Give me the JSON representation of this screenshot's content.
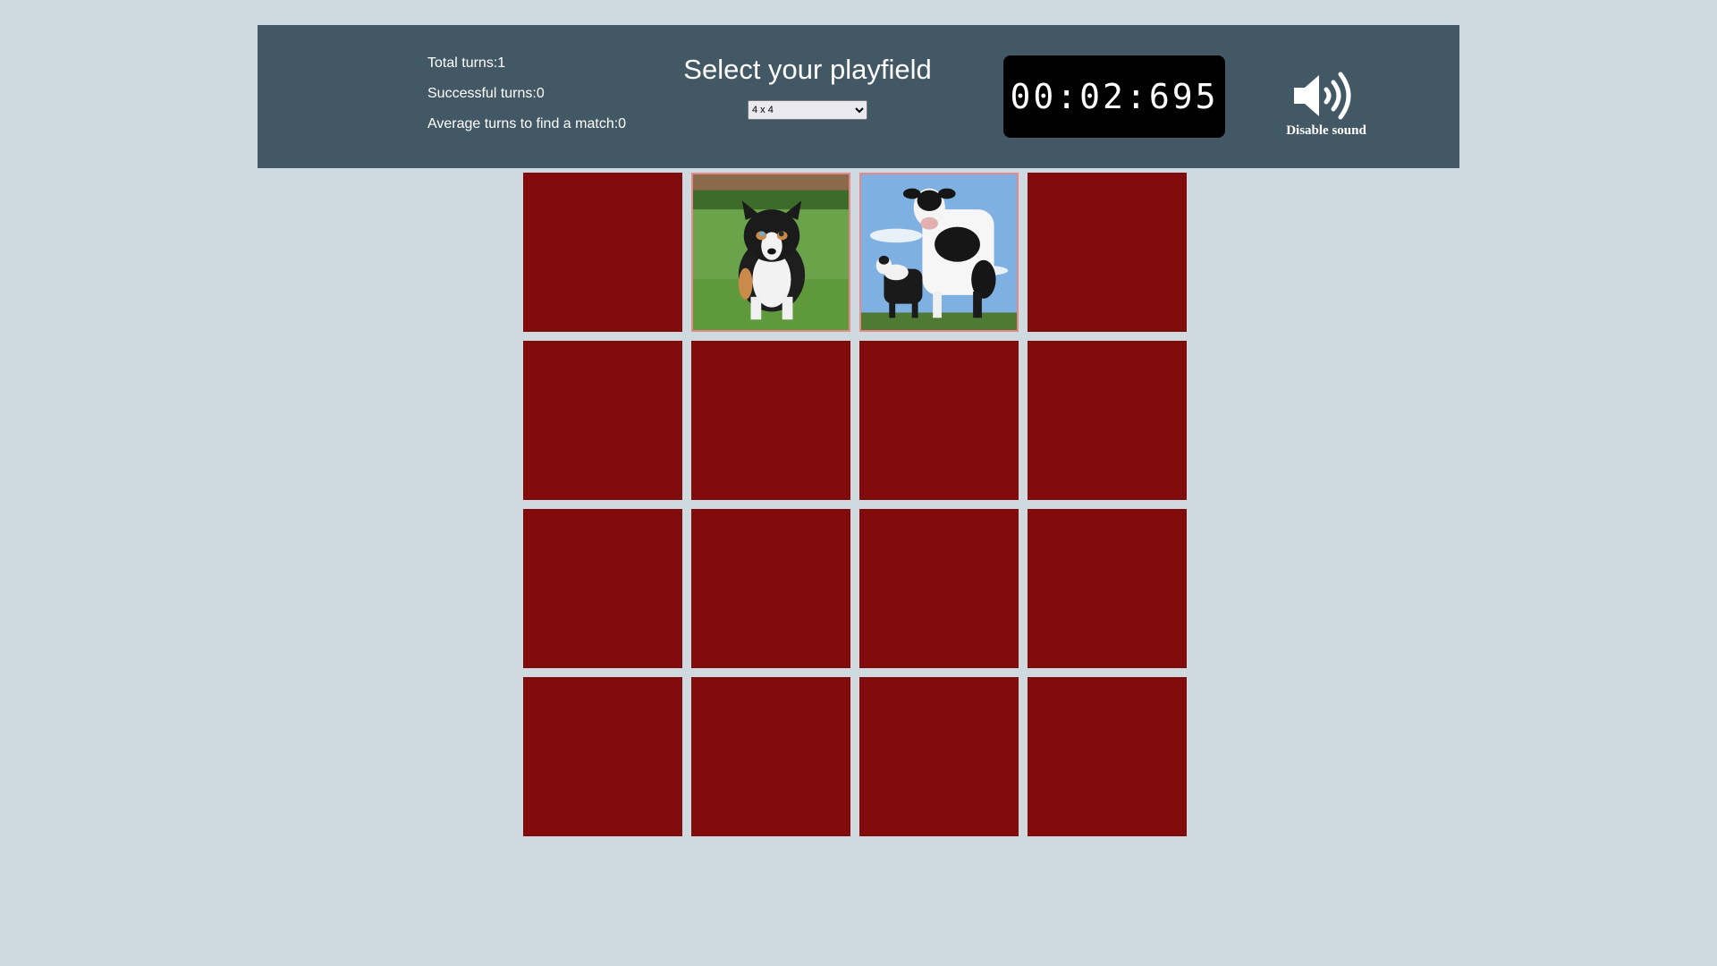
{
  "stats": {
    "total_turns": "Total turns:1",
    "successful_turns": "Successful turns:0",
    "average_turns": "Average turns to find a match:0"
  },
  "playfield": {
    "title": "Select your playfield",
    "selected": "4 x 4"
  },
  "timer": {
    "display": "00:02:695"
  },
  "sound": {
    "label": "Disable sound",
    "icon": "speaker-icon"
  },
  "board": {
    "rows": 4,
    "cols": 4,
    "card_back_color": "#820b0b",
    "flipped_border_color": "#e6878a",
    "cards": [
      {
        "state": "hidden"
      },
      {
        "state": "flipped",
        "image": "puppy"
      },
      {
        "state": "flipped",
        "image": "cows"
      },
      {
        "state": "hidden"
      },
      {
        "state": "hidden"
      },
      {
        "state": "hidden"
      },
      {
        "state": "hidden"
      },
      {
        "state": "hidden"
      },
      {
        "state": "hidden"
      },
      {
        "state": "hidden"
      },
      {
        "state": "hidden"
      },
      {
        "state": "hidden"
      },
      {
        "state": "hidden"
      },
      {
        "state": "hidden"
      },
      {
        "state": "hidden"
      },
      {
        "state": "hidden"
      }
    ]
  }
}
